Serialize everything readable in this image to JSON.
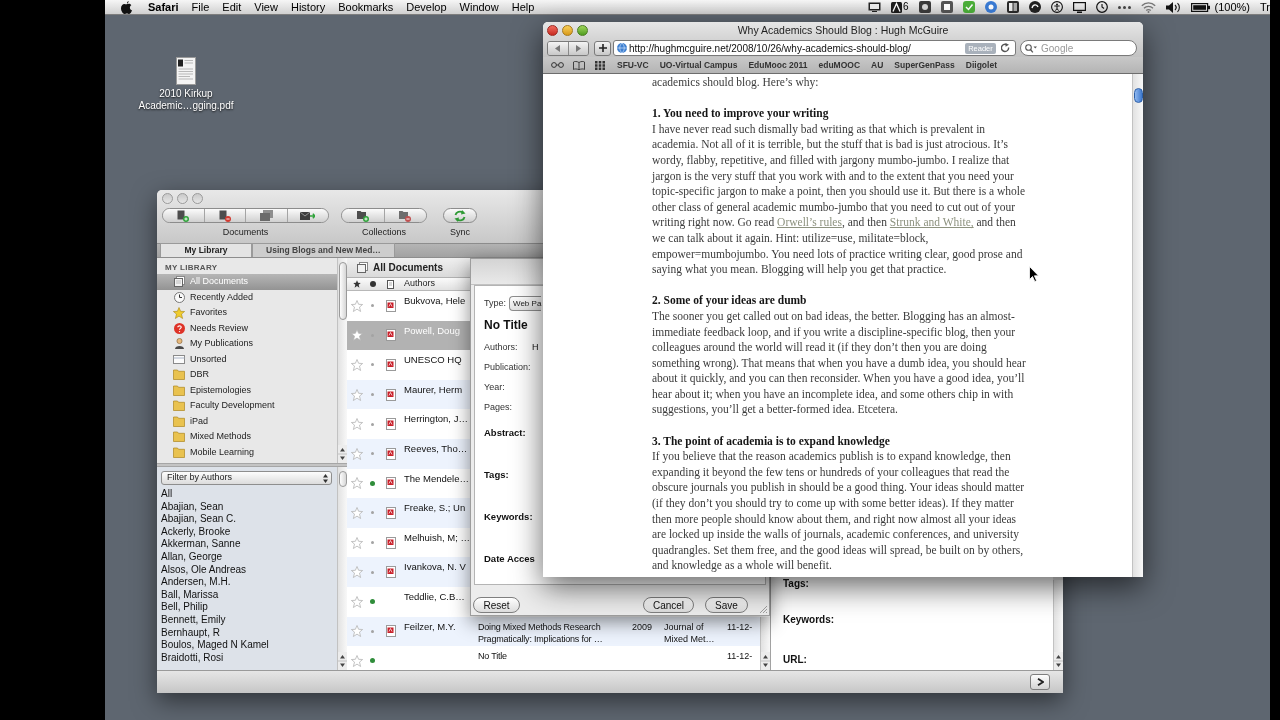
{
  "menu_bar": {
    "app_name": "Safari",
    "menus": [
      "File",
      "Edit",
      "View",
      "History",
      "Bookmarks",
      "Develop",
      "Window",
      "Help"
    ],
    "status": {
      "badge_count": "6",
      "battery": "(100%)",
      "cut_text": "Tr"
    }
  },
  "desktop": {
    "files": [
      {
        "label": "2010 Kirkup Academic…gging.pdf"
      }
    ]
  },
  "library_window": {
    "toolbar_groups": [
      {
        "kind": "documents",
        "label": "Documents"
      },
      {
        "kind": "collections",
        "label": "Collections"
      },
      {
        "kind": "sync",
        "label": "Sync"
      }
    ],
    "tabs": [
      {
        "label": "My Library",
        "selected": true
      },
      {
        "label": "Using Blogs and New Med…",
        "selected": false
      }
    ],
    "sidebar": {
      "heading": "MY LIBRARY",
      "items": [
        {
          "kind": "all",
          "label": "All Documents",
          "selected": true
        },
        {
          "kind": "recent",
          "label": "Recently Added",
          "selected": false
        },
        {
          "kind": "favorites",
          "label": "Favorites",
          "selected": false
        },
        {
          "kind": "review",
          "label": "Needs Review",
          "selected": false
        },
        {
          "kind": "publications",
          "label": "My Publications",
          "selected": false
        },
        {
          "kind": "unsorted",
          "label": "Unsorted",
          "selected": false
        },
        {
          "kind": "folder",
          "label": "DBR",
          "selected": false
        },
        {
          "kind": "folder",
          "label": "Epistemologies",
          "selected": false
        },
        {
          "kind": "folder",
          "label": "Faculty Development",
          "selected": false
        },
        {
          "kind": "folder",
          "label": "iPad",
          "selected": false
        },
        {
          "kind": "folder",
          "label": "Mixed Methods",
          "selected": false
        },
        {
          "kind": "folder",
          "label": "Mobile Learning",
          "selected": false
        }
      ]
    },
    "author_filter": {
      "value": "Filter by Authors",
      "authors": [
        "All",
        "Abajian, Sean",
        "Abajian, Sean C.",
        "Ackerly, Brooke",
        "Akkerman, Sanne",
        "Allan, George",
        "Alsos, Ole Andreas",
        "Andersen, M.H.",
        "Ball, Marissa",
        "Bell, Philip",
        "Bennett, Emily",
        "Bernhaupt, R",
        "Boulos, Maged N Kamel",
        "Braidotti, Rosi"
      ]
    },
    "document_list": {
      "title": "All Documents",
      "columns": [
        "Authors"
      ],
      "rows": [
        {
          "authors": "Bukvova, Hele",
          "unread": false,
          "has_pdf": true,
          "selected": false
        },
        {
          "authors": "Powell, Doug",
          "unread": false,
          "has_pdf": true,
          "selected": true
        },
        {
          "authors": "UNESCO HQ",
          "unread": false,
          "has_pdf": true,
          "selected": false
        },
        {
          "authors": "Maurer, Herm",
          "unread": false,
          "has_pdf": true,
          "selected": false
        },
        {
          "authors": "Herrington, J…",
          "unread": false,
          "has_pdf": true,
          "selected": false
        },
        {
          "authors": "Reeves, Tho…",
          "unread": false,
          "has_pdf": true,
          "selected": false
        },
        {
          "authors": "The Mendele…",
          "unread": true,
          "has_pdf": true,
          "selected": false
        },
        {
          "authors": "Freake, S.; Un",
          "unread": false,
          "has_pdf": true,
          "selected": false
        },
        {
          "authors": "Melhuish, M; …",
          "unread": false,
          "has_pdf": true,
          "selected": false
        },
        {
          "authors": "Ivankova, N. V",
          "unread": false,
          "has_pdf": true,
          "selected": false
        },
        {
          "authors": "Teddlie, C.B…",
          "unread": true,
          "has_pdf": false,
          "selected": false
        },
        {
          "authors": "Feilzer, M.Y.",
          "unread": false,
          "has_pdf": true,
          "selected": false,
          "column_2": "Doing Mixed Methods Research Pragmatically: Implications for …",
          "column_3": "2009",
          "column_4": "Journal of Mixed Met…",
          "column_5": "11-12-"
        },
        {
          "unread": true,
          "has_pdf": false,
          "selected": false,
          "column_2": "No Title",
          "column_5": "11-12-"
        }
      ]
    },
    "details_panel": {
      "labels": [
        "Tags:",
        "Keywords:",
        "URL:"
      ]
    }
  },
  "edit_dialog": {
    "type_label": "Type:",
    "type_value": "Web Pa",
    "title": "No Title",
    "fields": [
      {
        "label": "Authors:",
        "value": "H"
      },
      {
        "label": "Publication:"
      },
      {
        "label": "Year:"
      },
      {
        "label": "Pages:"
      }
    ],
    "sections": [
      "Abstract:",
      "Tags:",
      "Keywords:",
      "Date Acces"
    ],
    "buttons": [
      {
        "kind": "reset",
        "label": "Reset"
      },
      {
        "kind": "cancel",
        "label": "Cancel"
      },
      {
        "kind": "save",
        "label": "Save"
      }
    ]
  },
  "browser": {
    "title": "Why Academics Should Blog : Hugh McGuire",
    "url": "http://hughmcguire.net/2008/10/26/why-academics-should-blog/",
    "reader": "Reader",
    "search_placeholder": "Google",
    "bookmarks": [
      "SFU-VC",
      "UO-Virtual Campus",
      "EduMooc 2011",
      "eduMOOC",
      "AU",
      "SuperGenPass",
      "Diigolet"
    ],
    "article": {
      "intro": "academics should blog. Here’s why:",
      "sections": [
        {
          "heading": "1. You need to improve your writing",
          "body": [
            {
              "kind": "text",
              "text": "I have never read such dismally bad writing as that which is prevalent in academia. Not all of it is terrible, but the stuff that is bad is just atrocious. It’s wordy, flabby, repetitive, and filled with jargony mumbo-jumbo. I realize that jargon is the very stuff that you work with and to the extent that you need your topic-specific jargon to make a point, then you should use it. But there is a whole other class of general academic mumbo-jumbo that you need to cut out of your writing right now. Go read "
            },
            {
              "kind": "link",
              "text": "Orwell’s rules"
            },
            {
              "kind": "text",
              "text": ", and then "
            },
            {
              "kind": "link",
              "text": "Strunk and White,"
            },
            {
              "kind": "text",
              "text": " and then we can talk about it again. Hint: utilize=use, militate=block, empower=mumbojumbo. You need lots of practice writing clear, good prose and saying what you mean. Blogging will help you get that practice."
            }
          ]
        },
        {
          "heading": "2. Some of your ideas are dumb",
          "body": [
            {
              "kind": "text",
              "text": "The sooner you get called out on bad ideas, the better. Blogging has an almost-immediate feedback loop, and if you write a discipline-specific blog, then your colleagues around the world will read it (if they don’t then you are doing something wrong). That means that when you have a dumb idea, you should hear about it quickly, and you can then reconsider. When you have a good idea, you’ll hear about it; when you have an incomplete idea, and some others chip in with suggestions, you’ll get a better-formed idea. Etcetera."
            }
          ]
        },
        {
          "heading": "3. The point of academia is to expand knowledge",
          "body": [
            {
              "kind": "text",
              "text": "If you believe that the reason academics publish is to expand knowledge, then expanding it beyond the few tens or hundreds of your colleagues that read the obscure journals you publish in should be a good thing. Your ideas should matter (if they don’t you should try to come up with some better ideas). If they matter then more people should know about them, and right now almost all your ideas are locked up inside the walls of journals, academic conferences, and university quadrangles. Set them free, and the good ideas will spread, be built on by others, and knowledge as a whole will benefit."
            }
          ]
        }
      ]
    }
  }
}
